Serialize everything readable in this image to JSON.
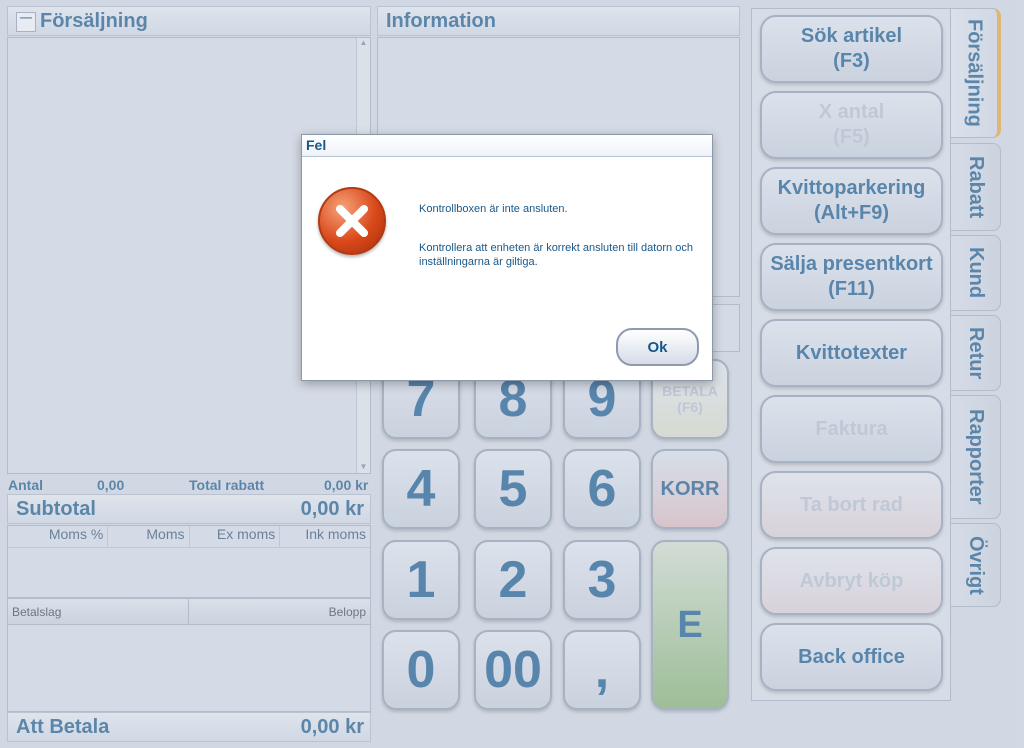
{
  "sales": {
    "title": "Försäljning",
    "antal_label": "Antal",
    "antal_value": "0,00",
    "rabatt_label": "Total rabatt",
    "rabatt_value": "0,00 kr",
    "subtotal_label": "Subtotal",
    "subtotal_value": "0,00 kr",
    "moms_headers": [
      "Moms %",
      "Moms",
      "Ex moms",
      "Ink moms"
    ],
    "pay_headers": [
      "Betalslag",
      "Belopp"
    ],
    "att_betala_label": "Att Betala",
    "att_betala_value": "0,00 kr"
  },
  "info": {
    "title": "Information"
  },
  "keypad": {
    "keys": [
      "7",
      "8",
      "9",
      "4",
      "5",
      "6",
      "1",
      "2",
      "3",
      "0",
      "00",
      ","
    ],
    "betala": "BETALA\n(F6)",
    "korr": "KORR",
    "enter": "E"
  },
  "functions": [
    {
      "label": "Sök artikel\n(F3)",
      "enabled": true
    },
    {
      "label": "X antal\n(F5)",
      "enabled": false
    },
    {
      "label": "Kvittoparkering\n(Alt+F9)",
      "enabled": true
    },
    {
      "label": "Sälja presentkort\n(F11)",
      "enabled": true
    },
    {
      "label": "Kvittotexter",
      "enabled": true
    },
    {
      "label": "Faktura",
      "enabled": false
    },
    {
      "label": "Ta bort rad",
      "enabled": false
    },
    {
      "label": "Avbryt köp",
      "enabled": false
    },
    {
      "label": "Back office",
      "enabled": true
    }
  ],
  "tabs": [
    "Försäljning",
    "Rabatt",
    "Kund",
    "Retur",
    "Rapporter",
    "Övrigt"
  ],
  "dialog": {
    "title": "Fel",
    "message1": "Kontrollboxen är inte ansluten.",
    "message2": "Kontrollera att enheten är korrekt ansluten till datorn och inställningarna är giltiga.",
    "ok_label": "Ok",
    "icon": "error-icon"
  },
  "colors": {
    "accent": "#1a5889",
    "error": "#d9481a",
    "active_tab": "#e0a43c",
    "enter": "#7fae6c"
  }
}
